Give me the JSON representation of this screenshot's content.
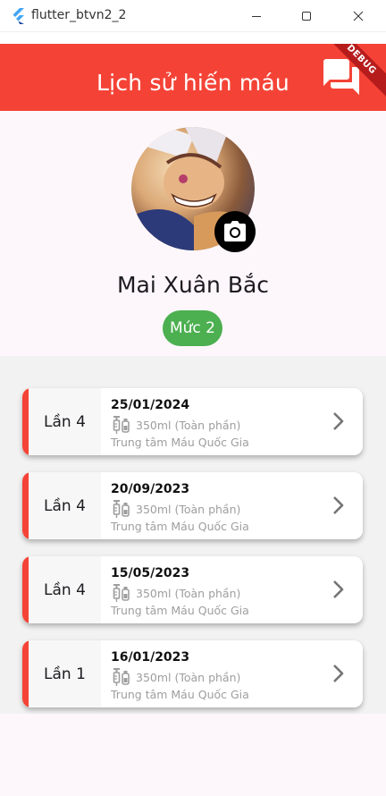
{
  "window": {
    "title": "flutter_btvn2_2"
  },
  "appbar": {
    "title": "Lịch sử hiến máu",
    "debug_label": "DEBUG",
    "color": "#f44336"
  },
  "profile": {
    "name": "Mai Xuân Bắc",
    "level": "Mức 2"
  },
  "donations": [
    {
      "count": "Lần 4",
      "date": "25/01/2024",
      "volume": "350ml (Toàn phần)",
      "place": "Trung tâm Máu Quốc Gia"
    },
    {
      "count": "Lần 4",
      "date": "20/09/2023",
      "volume": "350ml (Toàn phần)",
      "place": "Trung tâm Máu Quốc Gia"
    },
    {
      "count": "Lần 4",
      "date": "15/05/2023",
      "volume": "350ml (Toàn phần)",
      "place": "Trung tâm Máu Quốc Gia"
    },
    {
      "count": "Lần 1",
      "date": "16/01/2023",
      "volume": "350ml (Toàn phần)",
      "place": "Trung tâm Máu Quốc Gia"
    }
  ],
  "icons": {
    "app": "flutter-icon",
    "chat": "forum-icon",
    "camera": "camera-icon",
    "volume": "syringe-icon",
    "open": "chevron-right-icon"
  },
  "colors": {
    "accent": "#f44336",
    "level_badge": "#4caf50"
  }
}
